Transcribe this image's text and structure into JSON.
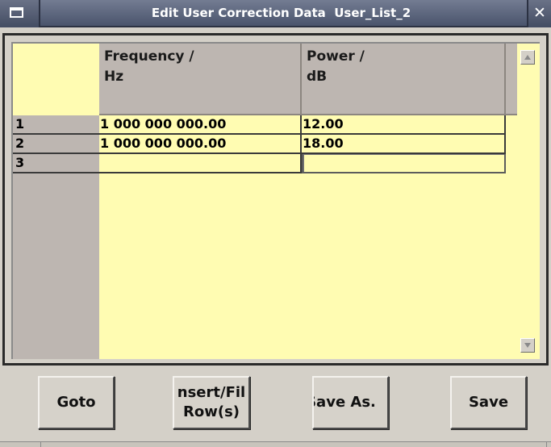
{
  "window": {
    "title": "Edit User Correction Data  User_List_2",
    "menu_icon": "window-menu-icon",
    "close_glyph": "✕"
  },
  "table": {
    "columns": [
      {
        "line1": "Frequency /",
        "line2": "Hz"
      },
      {
        "line1": "Power /",
        "line2": "dB"
      }
    ],
    "rows": [
      {
        "index": "1",
        "frequency": "1 000 000 000.00",
        "power": "12.00"
      },
      {
        "index": "2",
        "frequency": "1 000 000 000.00",
        "power": "18.00"
      },
      {
        "index": "3",
        "frequency": "",
        "power": ""
      }
    ],
    "selected_cell": {
      "row": 3,
      "column": "power"
    }
  },
  "scrollbar": {
    "up_icon": "arrow-up-icon",
    "down_icon": "arrow-down-icon"
  },
  "buttons": {
    "goto": "Goto",
    "insert_line1": "nsert/Fil",
    "insert_line2": "Row(s)",
    "save_as": "Save As.",
    "save": "Save"
  },
  "colors": {
    "table_background": "#fffcb2",
    "header_background": "#bdb6b1",
    "titlebar": "#4a546c"
  }
}
